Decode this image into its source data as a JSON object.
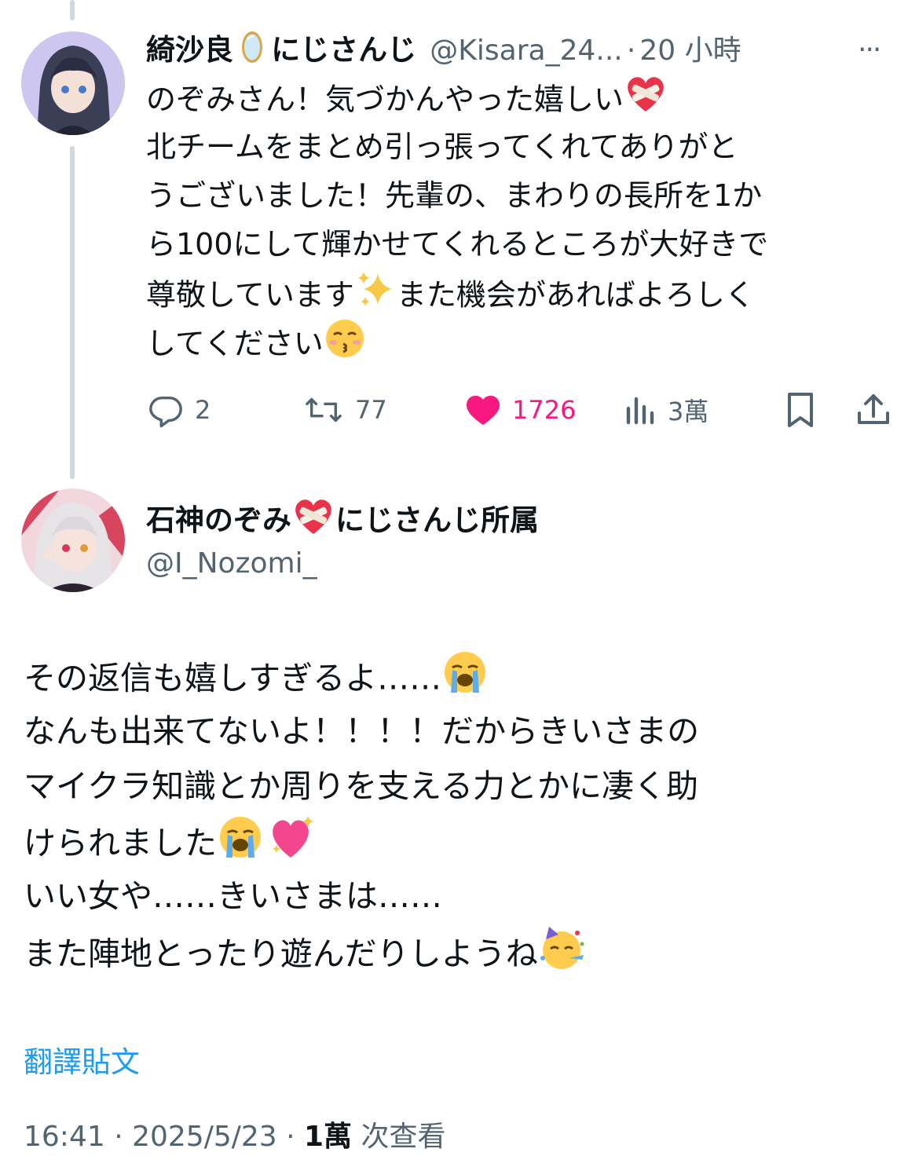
{
  "reply": {
    "display_name": "綺沙良",
    "org": "にじさんじ",
    "handle": "@Kisara_24...",
    "dot": "·",
    "time": "20 小時",
    "more": "···",
    "lines": [
      "のぞみさん！気づかんやった嬉しい",
      "北チームをまとめ引っ張ってくれてありがと",
      "うございました！先輩の、まわりの長所を1か",
      "ら100にして輝かせてくれるところが大好きで",
      "尊敬しています",
      "また機会があればよろしく",
      "してください"
    ],
    "actions": {
      "reply_count": "2",
      "retweet_count": "77",
      "like_count": "1726",
      "view_count": "3萬"
    }
  },
  "main": {
    "display_name_a": "石神のぞみ",
    "display_name_b": "にじさんじ所属",
    "handle": "@I_Nozomi_",
    "lines": [
      "その返信も嬉しすぎるよ……",
      "なんも出来てないよ！！！！だからきいさまの",
      "マイクラ知識とか周りを支える力とかに凄く助",
      "けられました",
      "いい女や……きいさまは……",
      "また陣地とったり遊んだりしようね"
    ],
    "translate": "翻譯貼文",
    "meta_time": "16:41 · 2025/5/23 · ",
    "meta_views": "1萬",
    "meta_suffix": " 次查看"
  },
  "colors": {
    "like": "#f91880",
    "link": "#1d9bf0",
    "muted": "#536471",
    "thread": "#cfd9de"
  },
  "icons": [
    "mirror-icon",
    "mended-heart-icon",
    "sparkles-icon",
    "kissing-face-icon",
    "reply-icon",
    "retweet-icon",
    "like-icon",
    "views-icon",
    "bookmark-icon",
    "share-icon",
    "crying-face-icon",
    "sparkling-heart-icon",
    "partying-face-icon"
  ]
}
